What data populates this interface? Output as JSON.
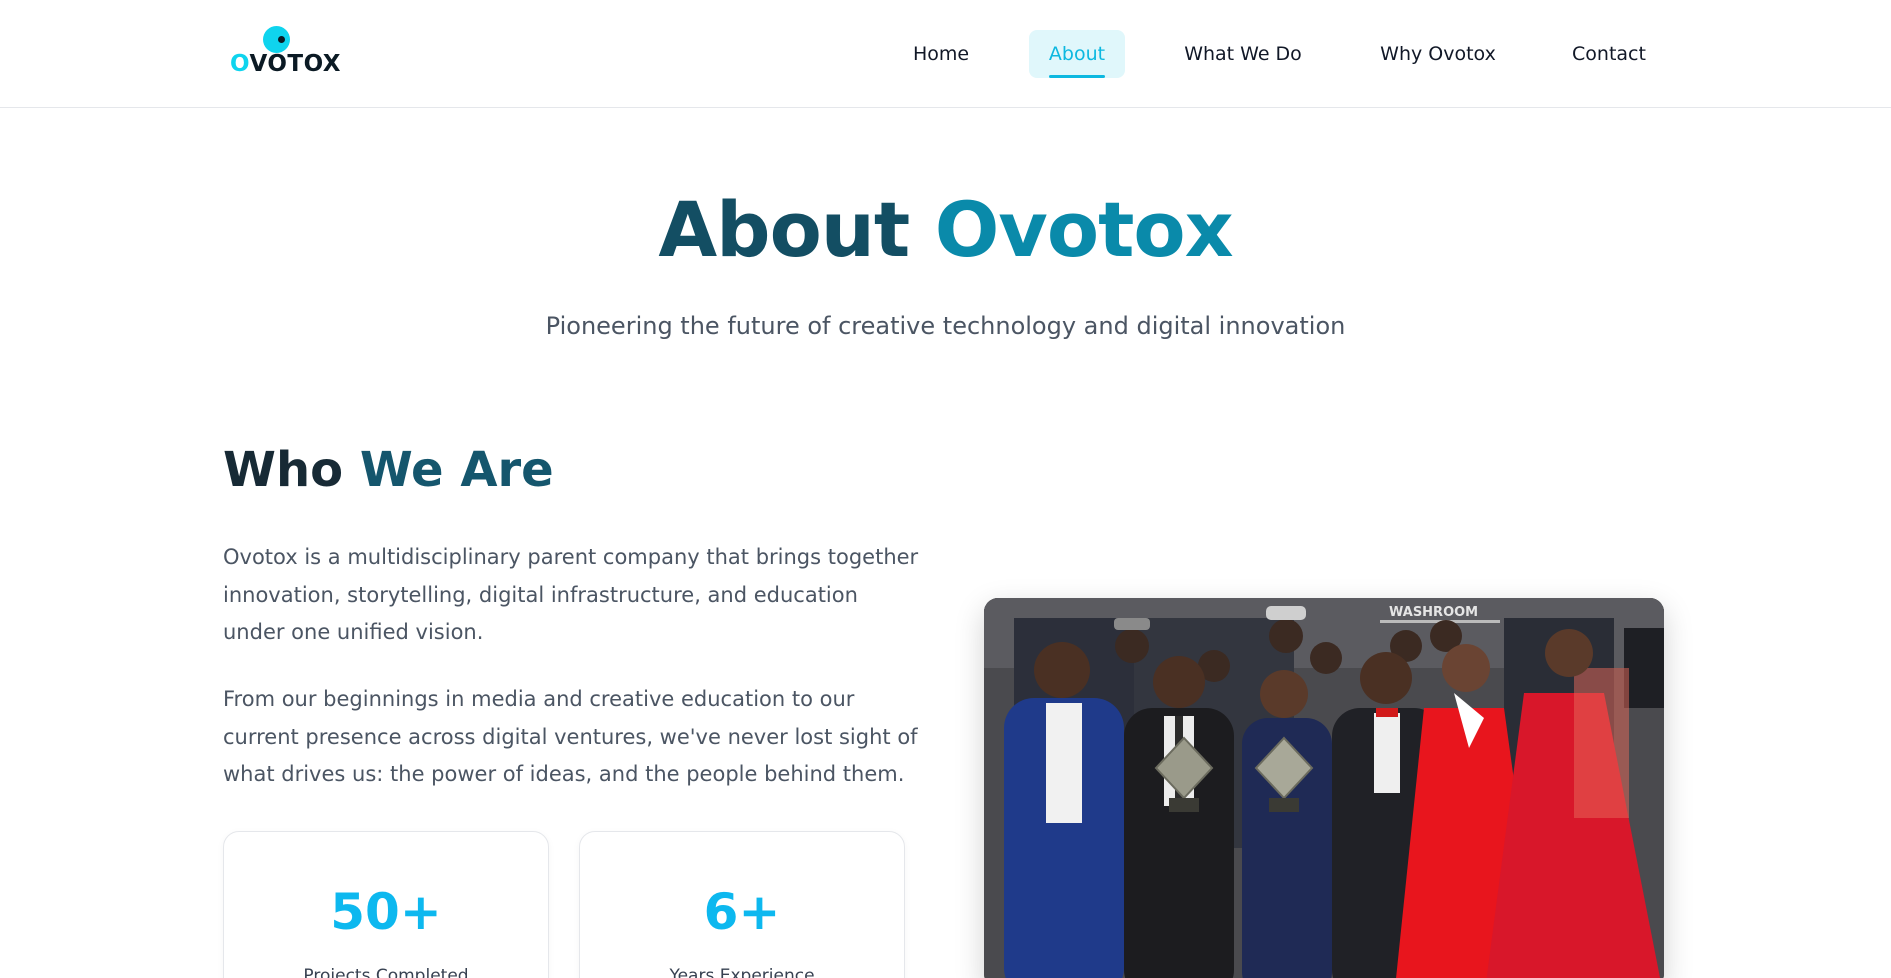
{
  "brand": {
    "logo_text_first": "O",
    "logo_text_rest": "VOTOX",
    "accent_color": "#0fd4ee"
  },
  "nav": {
    "items": [
      {
        "label": "Home"
      },
      {
        "label": "About"
      },
      {
        "label": "What We Do"
      },
      {
        "label": "Why Ovotox"
      },
      {
        "label": "Contact"
      }
    ],
    "active": "About"
  },
  "hero": {
    "title_part1": "About",
    "title_part2": "Ovotox",
    "subtitle": "Pioneering the future of creative technology and digital innovation"
  },
  "who": {
    "title_part1": "Who",
    "title_part2": "We Are",
    "paragraph1": "Ovotox is a multidisciplinary parent company that brings together innovation, storytelling, digital infrastructure, and education under one unified vision.",
    "paragraph2": "From our beginnings in media and creative education to our current presence across digital ventures, we've never lost sight of what drives us: the power of ideas, and the people behind them.",
    "stats": [
      {
        "value": "50+",
        "label": "Projects Completed"
      },
      {
        "value": "6+",
        "label": "Years Experience"
      }
    ]
  },
  "photo": {
    "banner_text": "WASHROOM",
    "description_icon": "team-photo"
  }
}
